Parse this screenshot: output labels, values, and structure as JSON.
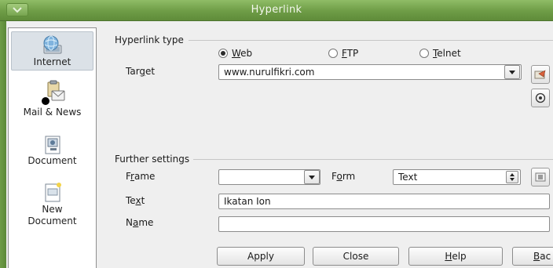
{
  "window": {
    "title": "Hyperlink"
  },
  "sidebar": {
    "items": [
      {
        "label": "Internet",
        "icon": "globe-monitor-icon",
        "selected": true
      },
      {
        "label": "Mail & News",
        "icon": "mail-clipboard-icon"
      },
      {
        "label": "Document",
        "icon": "document-target-icon"
      },
      {
        "label": "New",
        "label2": "Document",
        "icon": "new-document-icon"
      }
    ]
  },
  "hyperlink_type": {
    "section_label": "Hyperlink type",
    "options": [
      {
        "label": "Web",
        "selected": true
      },
      {
        "label": "FTP",
        "selected": false
      },
      {
        "label": "Telnet",
        "selected": false
      }
    ],
    "target_label": "Target",
    "target_value": "www.nurulfikri.com"
  },
  "further_settings": {
    "section_label": "Further settings",
    "frame_label": "Frame",
    "frame_value": "",
    "form_label": "Form",
    "form_value": "Text",
    "text_label": "Text",
    "text_value": "Ikatan Ion",
    "name_label": "Name",
    "name_value": ""
  },
  "buttons": {
    "apply": "Apply",
    "close": "Close",
    "help": "Help",
    "back": "Bac"
  }
}
